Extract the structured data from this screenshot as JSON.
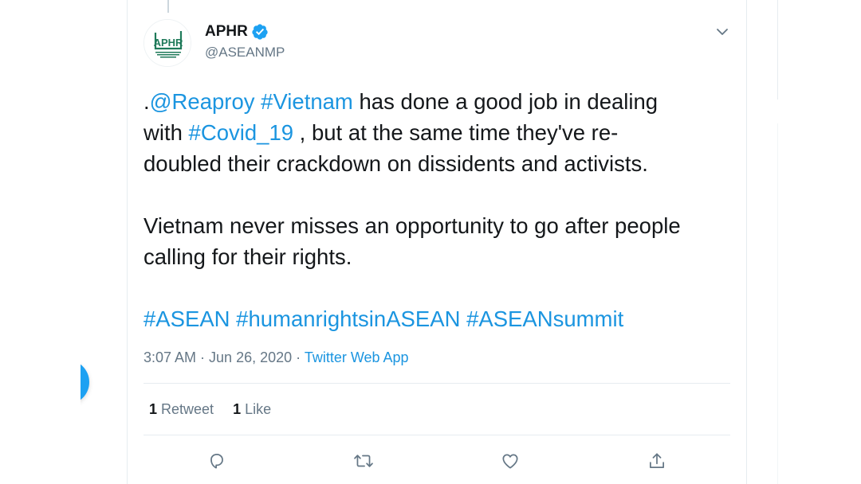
{
  "tweet": {
    "author": {
      "display_name": "APHR",
      "handle": "@ASEANMP",
      "avatar_text": "APHR",
      "verified": true
    },
    "text_lines": [
      [
        {
          "t": ".",
          "link": false
        },
        {
          "t": "@Reaproy",
          "link": true
        },
        {
          "t": " ",
          "link": false
        },
        {
          "t": "#Vietnam",
          "link": true
        },
        {
          "t": " has done a good job in dealing",
          "link": false
        }
      ],
      [
        {
          "t": "with ",
          "link": false
        },
        {
          "t": "#Covid_19",
          "link": true
        },
        {
          "t": " , but at the same time they've re-",
          "link": false
        }
      ],
      [
        {
          "t": "doubled their crackdown on dissidents and activists.",
          "link": false
        }
      ],
      [],
      [
        {
          "t": "Vietnam never misses an opportunity to go after people",
          "link": false
        }
      ],
      [
        {
          "t": "calling for their rights.",
          "link": false
        }
      ],
      [],
      [
        {
          "t": "#ASEAN",
          "link": true
        },
        {
          "t": " ",
          "link": false
        },
        {
          "t": "#humanrightsinASEAN",
          "link": true
        },
        {
          "t": " ",
          "link": false
        },
        {
          "t": "#ASEANsummit",
          "link": true
        }
      ]
    ],
    "meta": {
      "time": "3:07 AM",
      "separator": " · ",
      "date": "Jun 26, 2020",
      "source": "Twitter Web App"
    },
    "stats": {
      "retweets_count": "1",
      "retweets_label": "Retweet",
      "likes_count": "1",
      "likes_label": "Like"
    },
    "actions": {
      "reply_icon": "reply-icon",
      "retweet_icon": "retweet-icon",
      "like_icon": "heart-icon",
      "share_icon": "share-icon"
    }
  },
  "colors": {
    "link": "#1b95e0",
    "text": "#14171a",
    "secondary": "#657786",
    "border": "#e6ecf0",
    "brand_blue": "#1da1f2",
    "avatar_green": "#1f7a5a"
  }
}
